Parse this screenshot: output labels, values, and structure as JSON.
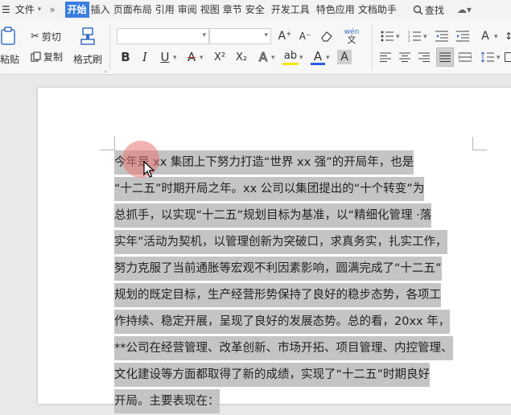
{
  "menu": {
    "file_label": "文件",
    "tabs": [
      "开始",
      "插入",
      "页面布局",
      "引用",
      "审阅",
      "视图",
      "章节",
      "安全",
      "开发工具",
      "特色应用",
      "文档助手"
    ],
    "search_label": "查找"
  },
  "ribbon": {
    "paste_label": "粘贴",
    "cut_label": "剪切",
    "copy_label": "复制",
    "format_painter_label": "格式刷",
    "font_name_value": "",
    "font_size_value": "",
    "bold": "B",
    "italic": "I",
    "underline": "U",
    "strike": "A",
    "superscript": "X²",
    "subscript": "X₂",
    "text_effect": "A",
    "highlight": "ab",
    "font_color": "A",
    "char_shading": "A",
    "grow_font": "A⁺",
    "shrink_font": "A⁻",
    "pinyin": "wén",
    "colors": {
      "accent": "#3a7ce1",
      "underline_red": "#e03b3b",
      "highlight_yellow": "#f5e60a",
      "font_blue": "#2a5ce6"
    }
  },
  "document": {
    "lines": [
      "今年是 xx 集团上下努力打造“世界 xx 强”的开局年，也是",
      "“十二五”时期开局之年。xx 公司以集团提出的“十个转变”为",
      "总抓手，以实现“十二五”规划目标为基准，以“精细化管理 ·落",
      "实年”活动为契机，以管理创新为突破口，求真务实，扎实工作，",
      "努力克服了当前通胀等宏观不利因素影响，圆满完成了“十二五”",
      "规划的既定目标，生产经营形势保持了良好的稳步态势，各项工",
      "作持续、稳定开展，呈现了良好的发展态势。总的看，20xx 年，",
      "**公司在经营管理、改革创新、市场开拓、项目管理、内控管理、",
      "文化建设等方面都取得了新的成绩，实现了“十二五”时期良好",
      "开局。主要表现在："
    ]
  }
}
